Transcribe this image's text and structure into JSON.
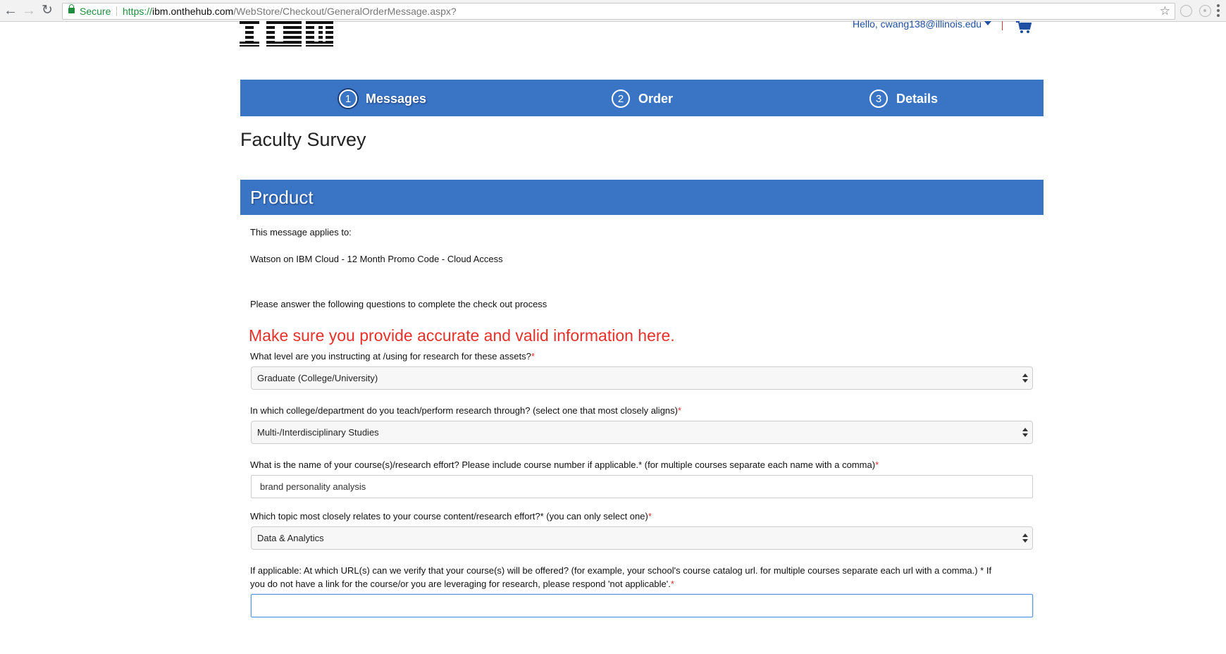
{
  "browser": {
    "secure_label": "Secure",
    "url_scheme": "https://",
    "url_domain": "ibm.onthehub.com",
    "url_path": "/WebStore/Checkout/GeneralOrderMessage.aspx?"
  },
  "header": {
    "logo_text": "IBM",
    "user_greeting": "Hello, cwang138@illinois.edu"
  },
  "steps": [
    {
      "number": "1",
      "label": "Messages"
    },
    {
      "number": "2",
      "label": "Order"
    },
    {
      "number": "3",
      "label": "Details"
    }
  ],
  "page_title": "Faculty Survey",
  "section_title": "Product",
  "applies_to_label": "This message applies to:",
  "product_name": "Watson on IBM Cloud - 12 Month Promo Code - Cloud Access",
  "instructions": "Please answer the following questions to complete the check out process",
  "warning": "Make sure you provide accurate and valid information here.",
  "required_mark": "*",
  "questions": [
    {
      "label": "What level are you instructing at /using for research for these assets?",
      "value": "Graduate (College/University)"
    },
    {
      "label": "In which college/department do you teach/perform research through? (select one that most closely aligns)",
      "value": "Multi-/Interdisciplinary Studies"
    },
    {
      "label": "What is the name of your course(s)/research effort? Please include course number if applicable.* (for multiple courses separate each name with a comma)",
      "value": "brand personality analysis"
    },
    {
      "label": "Which topic most closely relates to your course content/research effort?* (you can only select one)",
      "value": "Data & Analytics"
    },
    {
      "label_line1": "If applicable: At which URL(s) can we verify that your course(s) will be offered? (for example, your school's course catalog url. for multiple courses separate each url with a comma.) * If",
      "label_line2": "you do not have a link for the course/or you are leveraging for research, please respond 'not applicable'.",
      "value": ""
    }
  ],
  "colors": {
    "accent": "#3a74c4",
    "warning": "#e8302a",
    "secure": "#1e8e3e"
  }
}
